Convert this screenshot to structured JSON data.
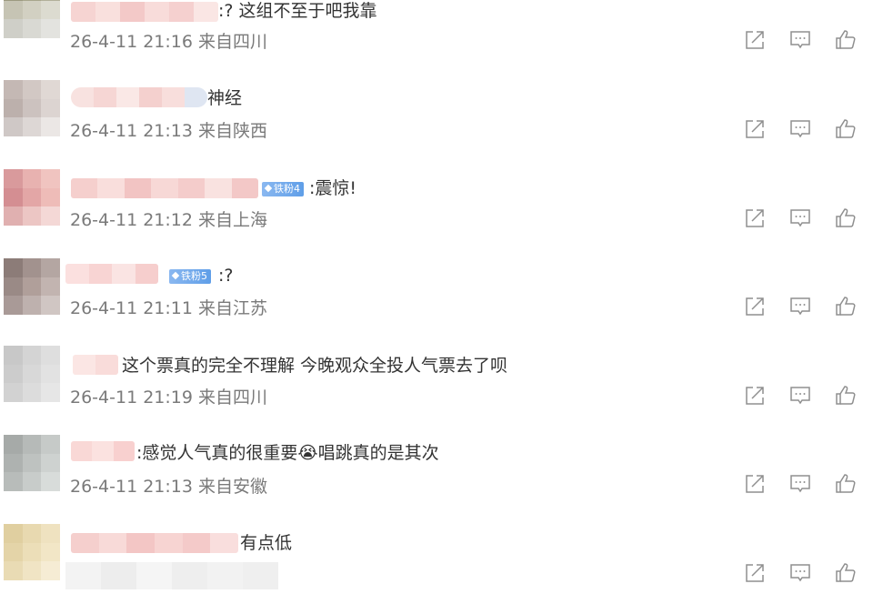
{
  "comments": [
    {
      "text": ":? 这组不至于吧我靠",
      "fan_badge": "",
      "time": "26-4-11 21:16",
      "location": "来自四川",
      "avatar_colors": [
        "#9c9a80",
        "#a8a68c",
        "#b2b09a",
        "#c6c4b4",
        "#d2d0c2",
        "#dcdbd0",
        "#cfcfc8",
        "#d9d9d3",
        "#e3e3df"
      ]
    },
    {
      "text": "神经",
      "fan_badge": "",
      "time": "26-4-11 21:13",
      "location": "来自陕西",
      "avatar_colors": [
        "#c4b8b4",
        "#d2c8c4",
        "#e0d8d4",
        "#bcb0ac",
        "#ccc2bf",
        "#dcd4d1",
        "#cfc8c6",
        "#ddd7d5",
        "#ebe7e5"
      ]
    },
    {
      "text": ":震惊!",
      "fan_badge": "铁粉4",
      "time": "26-4-11 21:12",
      "location": "来自上海",
      "avatar_colors": [
        "#d99a9c",
        "#e8b2b0",
        "#f0c4c0",
        "#d48e92",
        "#e3a6a6",
        "#eebcb8",
        "#e0b0b0",
        "#ecc6c4",
        "#f4d8d6"
      ]
    },
    {
      "text": ":?",
      "fan_badge": "铁粉5",
      "time": "26-4-11 21:11",
      "location": "来自江苏",
      "avatar_colors": [
        "#8c7c78",
        "#a2928e",
        "#b4a6a2",
        "#9a8a86",
        "#b09f9a",
        "#c2b4b0",
        "#a99a97",
        "#beb1ae",
        "#d0c6c3"
      ]
    },
    {
      "text": "这个票真的完全不理解 今晚观众全投人气票去了呗",
      "fan_badge": "",
      "time": "26-4-11 21:19",
      "location": "来自四川",
      "avatar_colors": [
        "#c8c8c8",
        "#d4d4d4",
        "#dedede",
        "#cccccc",
        "#d8d8d8",
        "#e2e2e2",
        "#d2d2d2",
        "#dcdcdc",
        "#e6e6e6"
      ]
    },
    {
      "text": ":感觉人气真的很重要😭唱跳真的是其次",
      "fan_badge": "",
      "time": "26-4-11 21:13",
      "location": "来自安徽",
      "avatar_colors": [
        "#a6aaa8",
        "#b6bab8",
        "#c6cac8",
        "#aeb2b0",
        "#bec2c0",
        "#ced2d0",
        "#b8bcba",
        "#c8ccca",
        "#d8dcda"
      ]
    },
    {
      "text": "有点低",
      "fan_badge": "",
      "time": "",
      "location": "",
      "avatar_colors": [
        "#e0cfa0",
        "#e8d9b0",
        "#efe2c0",
        "#e4d4a8",
        "#ecdeb8",
        "#f2e6c6",
        "#e9dbb4",
        "#f0e4c4",
        "#f6ecd4"
      ]
    }
  ]
}
